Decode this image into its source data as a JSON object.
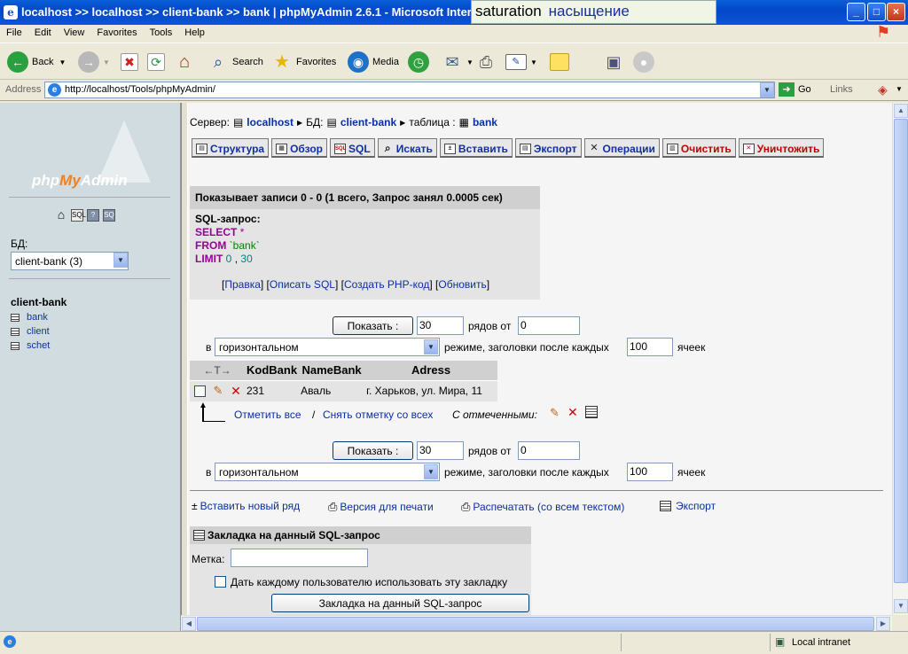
{
  "window": {
    "title": "localhost >> localhost >> client-bank >> bank | phpMyAdmin 2.6.1 - Microsoft Internet Explorer",
    "minimize": "_",
    "maximize": "□",
    "close": "×"
  },
  "tooltip": {
    "en": "saturation",
    "ru": "насыщение"
  },
  "menu": [
    "File",
    "Edit",
    "View",
    "Favorites",
    "Tools",
    "Help"
  ],
  "toolbar": {
    "back": "Back",
    "search": "Search",
    "favorites": "Favorites",
    "media": "Media"
  },
  "address": {
    "label": "Address",
    "url": "http://localhost/Tools/phpMyAdmin/",
    "go": "Go",
    "links": "Links"
  },
  "left": {
    "logo_php": "php",
    "logo_my": "My",
    "logo_admin": "Admin",
    "db_label": "БД:",
    "db_select": "client-bank (3)",
    "db_name": "client-bank",
    "tables": [
      "bank",
      "client",
      "schet"
    ]
  },
  "breadcrumb": {
    "server_label": "Сервер:",
    "server": "localhost",
    "db_label": "БД:",
    "db": "client-bank",
    "table_label": "таблица :",
    "table": "bank"
  },
  "tabs": [
    {
      "label": "Структура",
      "icon": "▤"
    },
    {
      "label": "Обзор",
      "icon": "▦"
    },
    {
      "label": "SQL",
      "icon": "SQL"
    },
    {
      "label": "Искать",
      "icon": "⌕"
    },
    {
      "label": "Вставить",
      "icon": "±"
    },
    {
      "label": "Экспорт",
      "icon": "▤"
    },
    {
      "label": "Операции",
      "icon": "✕"
    },
    {
      "label": "Очистить",
      "icon": "▥"
    },
    {
      "label": "Уничтожить",
      "icon": "✕"
    }
  ],
  "result": {
    "header": "Показывает записи 0 - 0 (1 всего, Запрос занял 0.0005 сек)",
    "sql_title": "SQL-запрос:",
    "kw_select": "SELECT",
    "star": "*",
    "kw_from": "FROM",
    "table": "`bank`",
    "kw_limit": "LIMIT",
    "limit_0": "0",
    "comma": ",",
    "limit_30": "30",
    "links": {
      "edit": "Правка",
      "explain": "Описать SQL",
      "php": "Создать PHP-код",
      "refresh": "Обновить"
    }
  },
  "nav": {
    "show_button": "Показать :",
    "rows_value": "30",
    "rows_from_label": "рядов от",
    "from_value": "0",
    "in_label": "в",
    "mode_value": "горизонтальном",
    "mode_suffix": "режиме, заголовки после каждых",
    "repeat_value": "100",
    "cells_label": "ячеек"
  },
  "table": {
    "arrows": "←T→",
    "columns": [
      "KodBank",
      "NameBank",
      "Adress"
    ],
    "rows": [
      {
        "KodBank": "231",
        "NameBank": "Аваль",
        "Adress": "г. Харьков, ул. Мира, 11"
      }
    ]
  },
  "checkactions": {
    "check_all": "Отметить все",
    "uncheck_all": "Снять отметку со всех",
    "with_selected": "С отмеченными:"
  },
  "footerlinks": {
    "insert": "Вставить новый ряд",
    "print_view": "Версия для печати",
    "print_full": "Распечатать (со всем текстом)",
    "export": "Экспорт"
  },
  "bookmark": {
    "title": "Закладка на данный SQL-запрос",
    "label_label": "Метка:",
    "label_value": "",
    "share_label": "Дать каждому пользователю использовать эту закладку",
    "button": "Закладка на данный SQL-запрос"
  },
  "status": {
    "zone": "Local intranet"
  }
}
